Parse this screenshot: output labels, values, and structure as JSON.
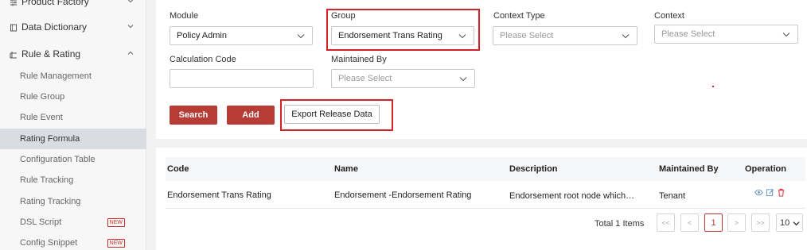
{
  "sidebar": {
    "groups": [
      {
        "label": "Product Factory",
        "icon": "sliders-icon"
      },
      {
        "label": "Data Dictionary",
        "icon": "book-icon"
      },
      {
        "label": "Rule & Rating",
        "icon": "ruler-icon"
      }
    ],
    "items": [
      {
        "label": "Rule Management"
      },
      {
        "label": "Rule Group"
      },
      {
        "label": "Rule Event"
      },
      {
        "label": "Rating Formula",
        "active": true
      },
      {
        "label": "Configuration Table"
      },
      {
        "label": "Rule Tracking"
      },
      {
        "label": "Rating Tracking"
      },
      {
        "label": "DSL Script",
        "badge": "NEW"
      },
      {
        "label": "Config Snippet",
        "badge": "NEW"
      }
    ]
  },
  "filters": {
    "module": {
      "label": "Module",
      "value": "Policy Admin"
    },
    "group": {
      "label": "Group",
      "value": "Endorsement Trans Rating"
    },
    "context_type": {
      "label": "Context Type",
      "placeholder": "Please Select"
    },
    "context": {
      "label": "Context",
      "placeholder": "Please Select"
    },
    "calculation_code": {
      "label": "Calculation Code",
      "value": ""
    },
    "maintained_by": {
      "label": "Maintained By",
      "placeholder": "Please Select"
    }
  },
  "actions": {
    "search": "Search",
    "add": "Add",
    "export": "Export Release Data"
  },
  "table": {
    "columns": [
      "Code",
      "Name",
      "Description",
      "Maintained By",
      "Operation"
    ],
    "rows": [
      {
        "code": "Endorsement Trans Rating",
        "name": "Endorsement -Endorsement Rating",
        "description": "Endorsement root node which…",
        "maintained_by": "Tenant"
      }
    ]
  },
  "pagination": {
    "total": "Total 1 Items",
    "first": "<<",
    "prev": "<",
    "current": "1",
    "next": ">",
    "last": ">>",
    "page_size": "10"
  },
  "colors": {
    "accent": "#b73c36",
    "highlight": "#d6202a",
    "badge": "#c9302c"
  }
}
